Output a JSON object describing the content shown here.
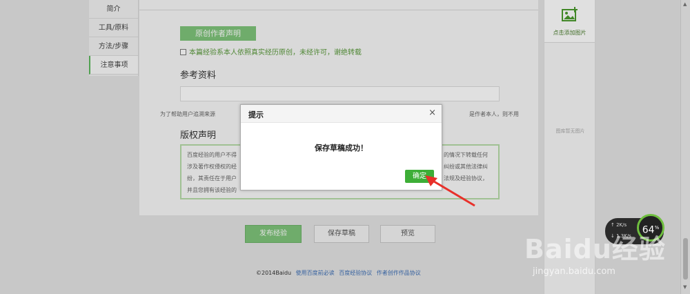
{
  "nav": {
    "items": [
      "简介",
      "工具/原料",
      "方法/步骤",
      "注意事项"
    ]
  },
  "original": {
    "badge": "原创作者声明",
    "check_text": "本篇经验系本人依照真实经历原创，未经许可，谢绝转载"
  },
  "reference": {
    "title": "参考资料",
    "hint_left": "为了帮助用户追溯来源",
    "hint_right": "是作者本人，则不用填写。"
  },
  "copyright": {
    "title": "版权声明",
    "lines": [
      "百度经验的用户不得",
      "涉及著作权侵权的经",
      "纷，其责任在于用户",
      "并且您拥有该经验的"
    ],
    "right_lines": [
      "的情况下转载任何",
      "纠纷或其他法律纠",
      "法规及经验协议，"
    ]
  },
  "actions": {
    "publish": "发布经验",
    "save_draft": "保存草稿",
    "preview": "预览"
  },
  "footer": {
    "copyright": "©2014Baidu",
    "links": [
      "使用百度前必读",
      "百度经验协议",
      "作者创作作品协议"
    ]
  },
  "right_panel": {
    "add_image": "点击添加图片",
    "empty_text": "图库暂无图片"
  },
  "dialog": {
    "title": "提示",
    "close": "×",
    "message": "保存草稿成功！",
    "ok": "确定"
  },
  "speed": {
    "up": "2K/s",
    "down": "1.3K/s",
    "percent": "64",
    "unit": "%"
  },
  "watermark": {
    "logo": "Baidu经验",
    "url": "jingyan.baidu.com"
  },
  "colors": {
    "accent_green": "#3dae37",
    "badge_green": "#7fc47a",
    "annotation_red": "#e8302a"
  }
}
